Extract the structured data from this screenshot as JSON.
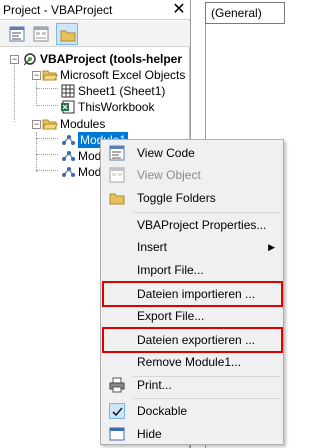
{
  "explorer": {
    "title": "Project - VBAProject",
    "close_glyph": "✕",
    "toolbar": [
      "view-code-icon",
      "view-object-icon",
      "toggle-folders-icon"
    ],
    "tree": {
      "project": "VBAProject (tools-helper",
      "excel_objects_folder": "Microsoft Excel Objects",
      "sheet1": "Sheet1 (Sheet1)",
      "this_workbook": "ThisWorkbook",
      "modules_folder": "Modules",
      "module1": "Module1",
      "module2_partial": "Mod",
      "module3_partial": "Mod"
    }
  },
  "codepane": {
    "object_combo": "(General)"
  },
  "context_menu": {
    "view_code": "View Code",
    "view_object": "View Object",
    "toggle_folders": "Toggle Folders",
    "vbaproject_properties": "VBAProject Properties...",
    "insert": "Insert",
    "import_file": "Import File...",
    "dateien_importieren": "Dateien importieren ...",
    "export_file": "Export File...",
    "dateien_exportieren": "Dateien exportieren ...",
    "remove_module": "Remove Module1...",
    "print": "Print...",
    "dockable": "Dockable",
    "hide": "Hide",
    "submenu_arrow": "▶"
  },
  "colors": {
    "selection": "#0078d7",
    "highlight_box": "#e00000",
    "menu_bg": "#f0f0f0"
  }
}
